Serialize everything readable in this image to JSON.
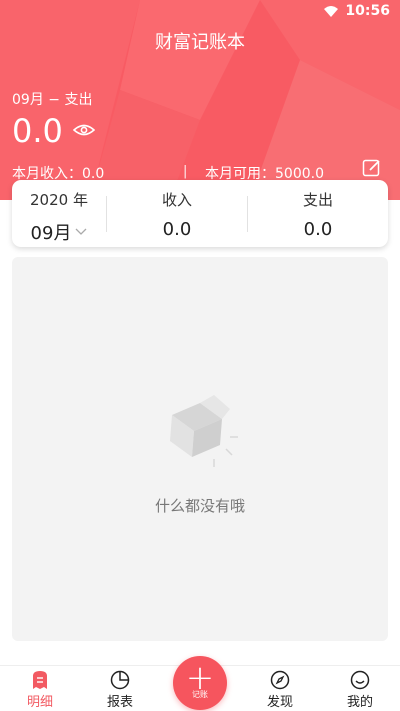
{
  "status": {
    "time": "10:56"
  },
  "header": {
    "title": "财富记账本",
    "month_label": "09月 − 支出",
    "balance": "0.0",
    "income_text": "本月收入：0.0",
    "divider": "|",
    "available_text": "本月可用：5000.0"
  },
  "summary": {
    "year": "2020 年",
    "month": "09月",
    "income_label": "收入",
    "income_value": "0.0",
    "expense_label": "支出",
    "expense_value": "0.0"
  },
  "list": {
    "empty_text": "什么都没有哦"
  },
  "tabs": [
    {
      "label": "明细",
      "icon": "bill-icon"
    },
    {
      "label": "报表",
      "icon": "pie-chart-icon"
    },
    {
      "label": "发现",
      "icon": "compass-icon"
    },
    {
      "label": "我的",
      "icon": "smile-icon"
    }
  ],
  "fab": {
    "label": "记账"
  },
  "colors": {
    "accent": "#f85b63",
    "panel": "#f3f3f3"
  }
}
